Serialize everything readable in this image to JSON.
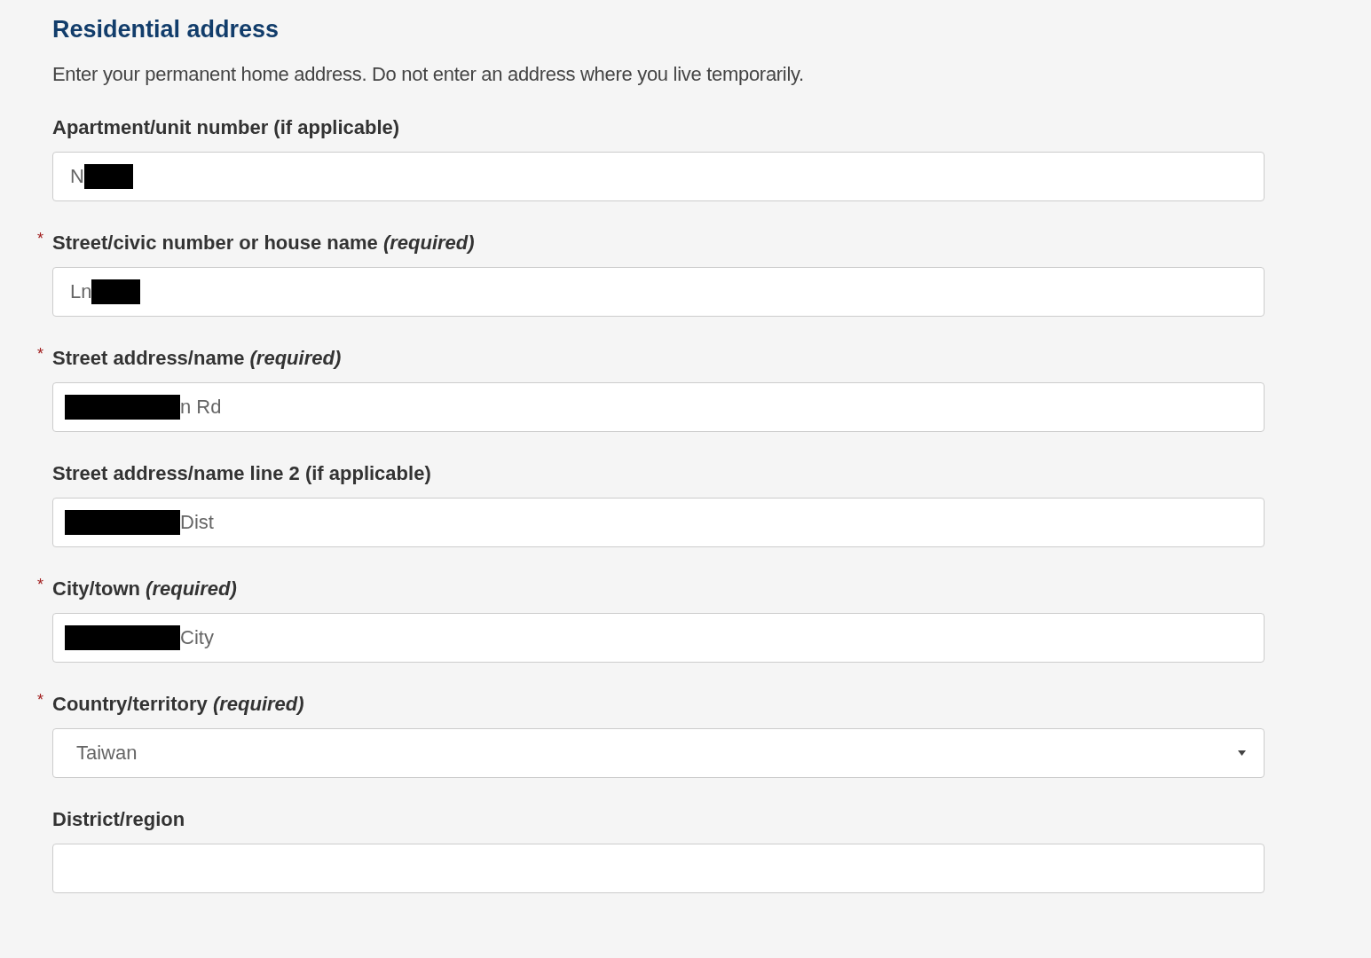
{
  "heading": "Residential address",
  "description": "Enter your permanent home address. Do not enter an address where you live temporarily.",
  "fields": [
    {
      "kind": "text",
      "label": "Apartment/unit number (if applicable)",
      "value_parts": [
        {
          "kind": "text",
          "text": "N"
        },
        {
          "kind": "redacted"
        }
      ]
    },
    {
      "kind": "text",
      "asterisk": "*",
      "label": "Street/civic number or house name *(required)*",
      "value_parts": [
        {
          "kind": "text",
          "text": "Ln"
        },
        {
          "kind": "redacted"
        }
      ]
    },
    {
      "kind": "text",
      "asterisk": "*",
      "label": "Street address/name *(required)*",
      "value_parts": [
        {
          "kind": "redacted"
        },
        {
          "kind": "text",
          "text": "n Rd"
        }
      ]
    },
    {
      "kind": "text",
      "label": "Street address/name line 2 (if applicable)",
      "value_parts": [
        {
          "kind": "redacted"
        },
        {
          "kind": "text",
          "text": "Dist"
        }
      ]
    },
    {
      "kind": "text",
      "asterisk": "*",
      "label": "City/town *(required)*",
      "value_parts": [
        {
          "kind": "redacted"
        },
        {
          "kind": "text",
          "text": "City"
        }
      ]
    },
    {
      "kind": "select",
      "asterisk": "*",
      "label": "Country/territory *(required)*",
      "value_parts": [
        {
          "kind": "text",
          "text": "Taiwan"
        }
      ]
    },
    {
      "kind": "text",
      "label": "District/region"
    }
  ]
}
